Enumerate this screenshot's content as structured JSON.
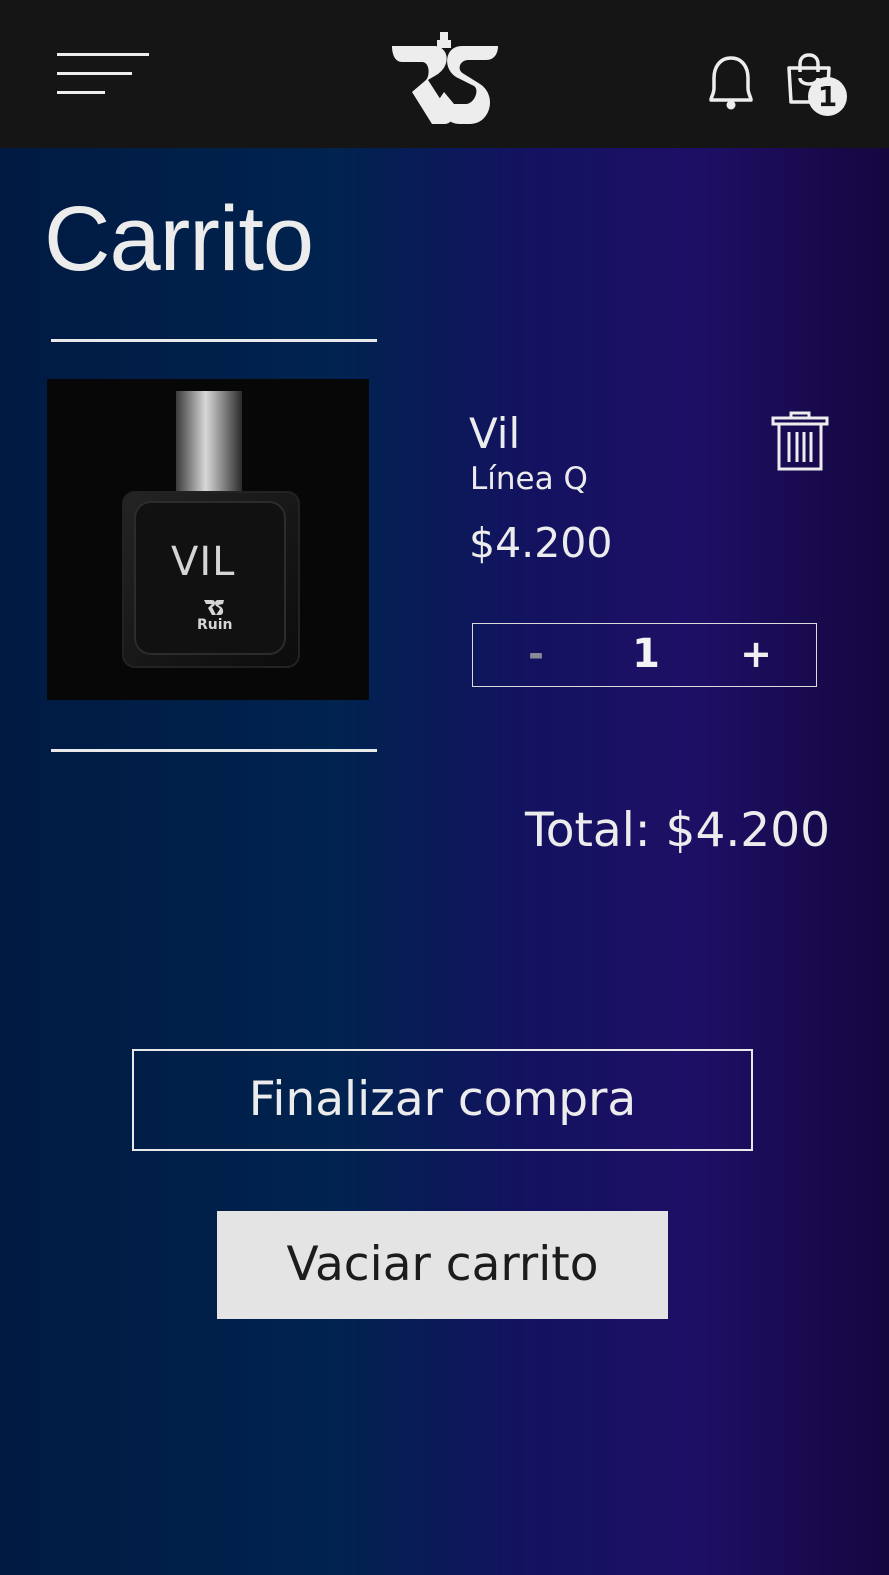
{
  "header": {
    "menu_icon": "hamburger-menu-icon",
    "logo_icon": "brand-logo-icon",
    "bell_icon": "bell-icon",
    "bag_icon": "shopping-bag-icon",
    "cart_count": "1"
  },
  "page": {
    "title": "Carrito"
  },
  "cart": {
    "items": [
      {
        "name": "Vil",
        "line": "Línea Q",
        "price": "$4.200",
        "quantity": "1",
        "image_label": "VIL",
        "image_brand": "Ruin",
        "delete_icon": "trash-icon"
      }
    ],
    "decrement_label": "-",
    "increment_label": "+",
    "total": "Total: $4.200"
  },
  "actions": {
    "checkout_label": "Finalizar compra",
    "empty_label": "Vaciar carrito"
  },
  "colors": {
    "header_bg": "#151515",
    "text": "#ececec",
    "empty_button_bg": "#e4e4e4"
  }
}
